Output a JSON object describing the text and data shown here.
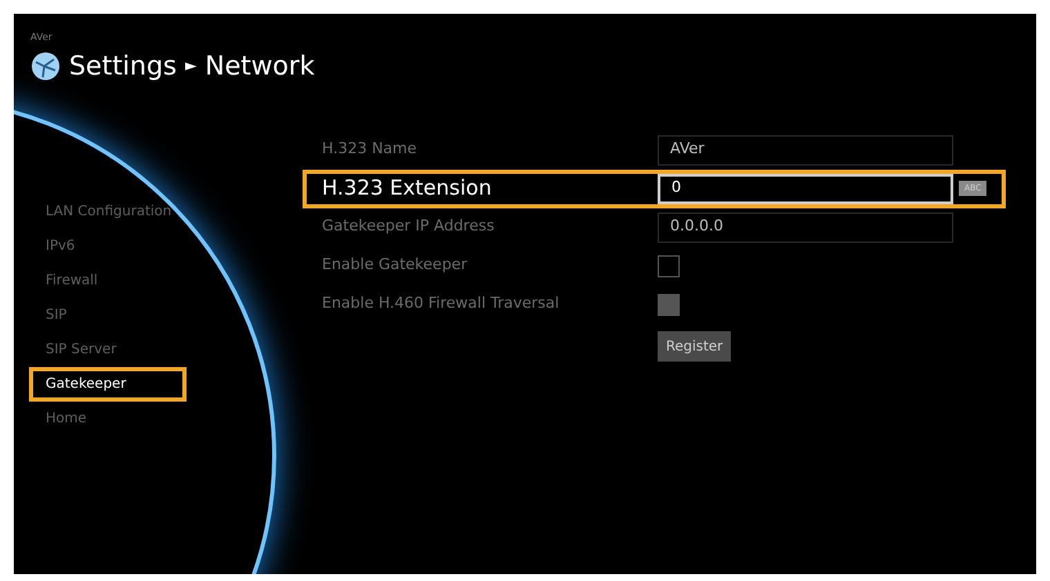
{
  "brand": "AVer",
  "breadcrumb": {
    "section": "Settings",
    "separator": "►",
    "page": "Network"
  },
  "nav": [
    {
      "label": "LAN Configuration",
      "selected": false,
      "highlighted": false
    },
    {
      "label": "IPv6",
      "selected": false,
      "highlighted": false
    },
    {
      "label": "Firewall",
      "selected": false,
      "highlighted": false
    },
    {
      "label": "SIP",
      "selected": false,
      "highlighted": false
    },
    {
      "label": "SIP Server",
      "selected": false,
      "highlighted": false
    },
    {
      "label": "Gatekeeper",
      "selected": true,
      "highlighted": true
    },
    {
      "label": "Home",
      "selected": false,
      "highlighted": false
    }
  ],
  "fields": [
    {
      "kind": "text",
      "label": "H.323 Name",
      "value": "AVer",
      "focused": false,
      "highlighted": false
    },
    {
      "kind": "text",
      "label": "H.323 Extension",
      "value": "0",
      "focused": true,
      "highlighted": true,
      "input_mode": "ABC"
    },
    {
      "kind": "text",
      "label": "Gatekeeper IP Address",
      "value": "0.0.0.0",
      "focused": false,
      "highlighted": false
    },
    {
      "kind": "checkbox",
      "label": "Enable Gatekeeper",
      "checked": false,
      "disabled": false
    },
    {
      "kind": "checkbox",
      "label": "Enable H.460 Firewall Traversal",
      "checked": false,
      "disabled": true
    }
  ],
  "register_button": "Register"
}
